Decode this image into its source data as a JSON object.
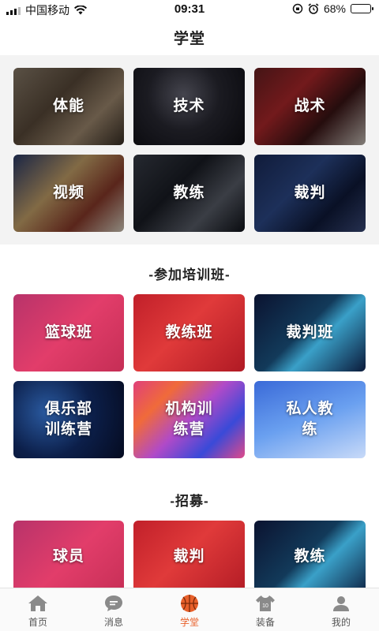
{
  "status_bar": {
    "carrier": "中国移动",
    "time": "09:31",
    "battery": "68%",
    "battery_level": 0.68
  },
  "header": {
    "title": "学堂"
  },
  "categories": [
    {
      "label": "体能"
    },
    {
      "label": "技术"
    },
    {
      "label": "战术"
    },
    {
      "label": "视频"
    },
    {
      "label": "教练"
    },
    {
      "label": "裁判"
    }
  ],
  "training": {
    "title": "-参加培训班-",
    "items": [
      {
        "label": "篮球班"
      },
      {
        "label": "教练班"
      },
      {
        "label": "裁判班"
      },
      {
        "label_line1": "俱乐部",
        "label_line2": "训练营"
      },
      {
        "label_line1": "机构训",
        "label_line2": "练营"
      },
      {
        "label_line1": "私人教",
        "label_line2": "练"
      }
    ]
  },
  "recruit": {
    "title": "-招募-",
    "items": [
      {
        "label": "球员"
      },
      {
        "label": "裁判"
      },
      {
        "label": "教练"
      }
    ]
  },
  "tab_bar": {
    "items": [
      {
        "label": "首页",
        "icon": "home-icon"
      },
      {
        "label": "消息",
        "icon": "message-icon"
      },
      {
        "label": "学堂",
        "icon": "basketball-icon"
      },
      {
        "label": "装备",
        "icon": "equipment-icon"
      },
      {
        "label": "我的",
        "icon": "profile-icon"
      }
    ],
    "active_index": 2,
    "active_color": "#e8602a",
    "inactive_color": "#8a8a8a"
  }
}
